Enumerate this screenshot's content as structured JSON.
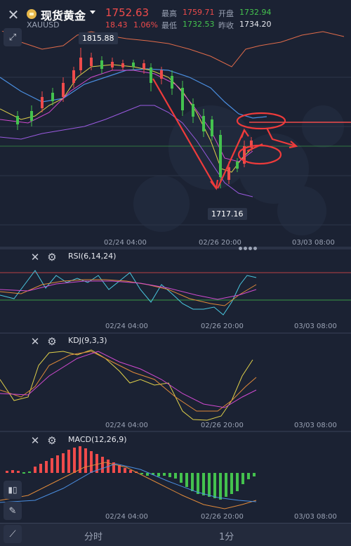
{
  "header": {
    "title": "现货黄金",
    "symbol": "XAUUSD",
    "price": "1752.63",
    "change": "18.43",
    "change_pct": "1.06%",
    "high_label": "最高",
    "high": "1759.71",
    "open_label": "开盘",
    "open": "1732.94",
    "low_label": "最低",
    "low": "1732.53",
    "prev_close_label": "昨收",
    "prev_close": "1734.20"
  },
  "main_chart": {
    "high_callout": "1815.88",
    "low_callout": "1717.16",
    "x_labels": [
      "02/24 04:00",
      "02/26 20:00",
      "03/03 08:00"
    ]
  },
  "rsi": {
    "label": "RSI(6,14,24)",
    "x_labels": [
      "02/24 04:00",
      "02/26 20:00",
      "03/03 08:00"
    ]
  },
  "kdj": {
    "label": "KDJ(9,3,3)",
    "x_labels": [
      "02/24 04:00",
      "02/26 20:00",
      "03/03 08:00"
    ]
  },
  "macd": {
    "label": "MACD(12,26,9)",
    "x_labels": [
      "02/24 04:00",
      "02/26 20:00",
      "03/03 08:00"
    ]
  },
  "tabs": [
    "分时",
    "1分"
  ],
  "colors": {
    "up": "#ef4b4b",
    "down": "#44c24e",
    "bg": "#1b2233"
  }
}
